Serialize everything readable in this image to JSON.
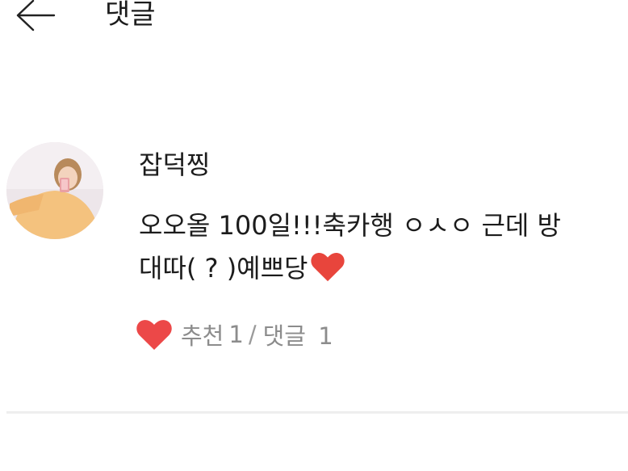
{
  "header": {
    "title": "댓글",
    "back_icon": "arrow-left-icon"
  },
  "comment": {
    "avatar_icon": "user-avatar",
    "username": "잡덕찡",
    "text": "오오올 100일!!!축카행 ㅇㅅㅇ 근데 방\n대따( ? )예쁘당",
    "text_end_icon": "heart-icon",
    "actions": {
      "like_icon": "heart-icon",
      "like_label": "추천",
      "like_count": "1",
      "separator": "/",
      "reply_label": "댓글",
      "reply_count": "1"
    }
  },
  "colors": {
    "heart": "#e8453c",
    "action_text": "#8c8c8c",
    "divider": "#eeeeee"
  }
}
